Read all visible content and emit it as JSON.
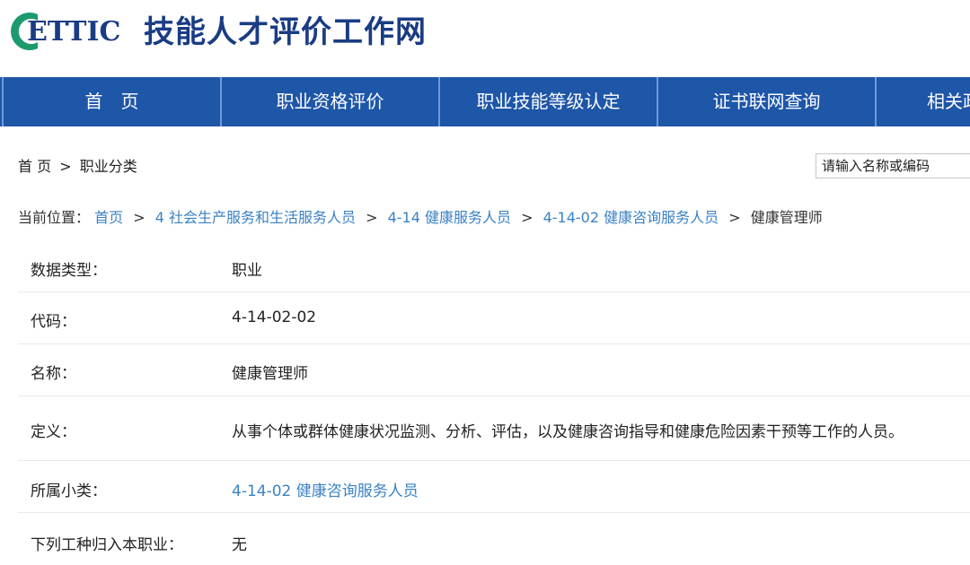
{
  "header": {
    "logo_text": "ETTIC",
    "site_title": "技能人才评价工作网"
  },
  "nav": {
    "items": [
      {
        "label": "首　页"
      },
      {
        "label": "职业资格评价"
      },
      {
        "label": "职业技能等级认定"
      },
      {
        "label": "证书联网查询"
      },
      {
        "label": "相关政"
      }
    ]
  },
  "top_breadcrumb": {
    "home": "首 页",
    "separator": ">",
    "current": "职业分类"
  },
  "search": {
    "placeholder": "请输入名称或编码"
  },
  "location": {
    "label": "当前位置：",
    "separator": ">",
    "links": [
      "首页",
      "4 社会生产服务和生活服务人员",
      "4-14 健康服务人员",
      "4-14-02 健康咨询服务人员"
    ],
    "current": "健康管理师"
  },
  "details": [
    {
      "label": "数据类型：",
      "value": "职业"
    },
    {
      "label": "代码：",
      "value": "4-14-02-02"
    },
    {
      "label": "名称：",
      "value": "健康管理师"
    },
    {
      "label": "定义：",
      "value": "从事个体或群体健康状况监测、分析、评估，以及健康咨询指导和健康危险因素干预等工作的人员。"
    },
    {
      "label": "所属小类：",
      "value": "4-14-02 健康咨询服务人员"
    },
    {
      "label": "下列工种归入本职业：",
      "value": "无"
    }
  ],
  "colors": {
    "nav_bg": "#1e56a8",
    "link": "#3a82c4",
    "title": "#1a3c84",
    "logo_green": "#1d9a6c"
  }
}
